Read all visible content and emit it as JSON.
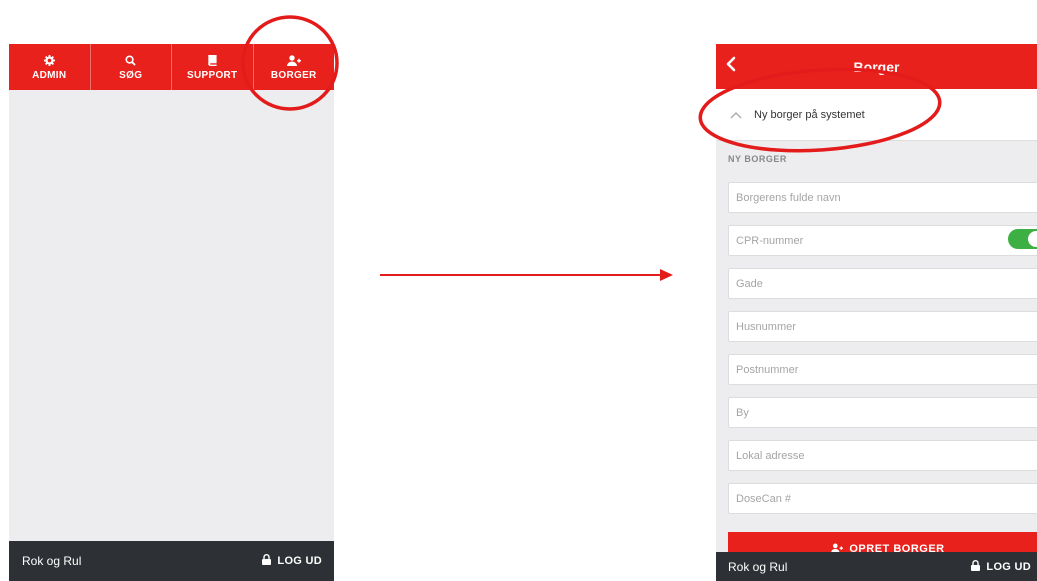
{
  "left_screen": {
    "nav": [
      {
        "label": "ADMIN",
        "icon": "gear-icon"
      },
      {
        "label": "SØG",
        "icon": "search-icon"
      },
      {
        "label": "SUPPORT",
        "icon": "book-icon"
      },
      {
        "label": "BORGER",
        "icon": "user-add-icon"
      }
    ],
    "footer": {
      "user": "Rok og Rul",
      "logout_label": "LOG UD"
    }
  },
  "right_screen": {
    "title": "Borger",
    "accordion_label": "Ny borger på systemet",
    "section_label": "NY BORGER",
    "fields": {
      "name": "Borgerens fulde navn",
      "cpr": "CPR-nummer",
      "street": "Gade",
      "house_number": "Husnummer",
      "postal_code": "Postnummer",
      "city": "By",
      "local_address": "Lokal adresse",
      "dosecan": "DoseCan #"
    },
    "cpr_toggle_on": true,
    "create_button": "OPRET BORGER",
    "footer": {
      "user": "Rok og Rul",
      "logout_label": "LOG UD"
    }
  },
  "colors": {
    "brand_red": "#e8211d",
    "footer_dark": "#2d3034",
    "toggle_green": "#3cb043",
    "annotation_red": "#e31b1b"
  }
}
